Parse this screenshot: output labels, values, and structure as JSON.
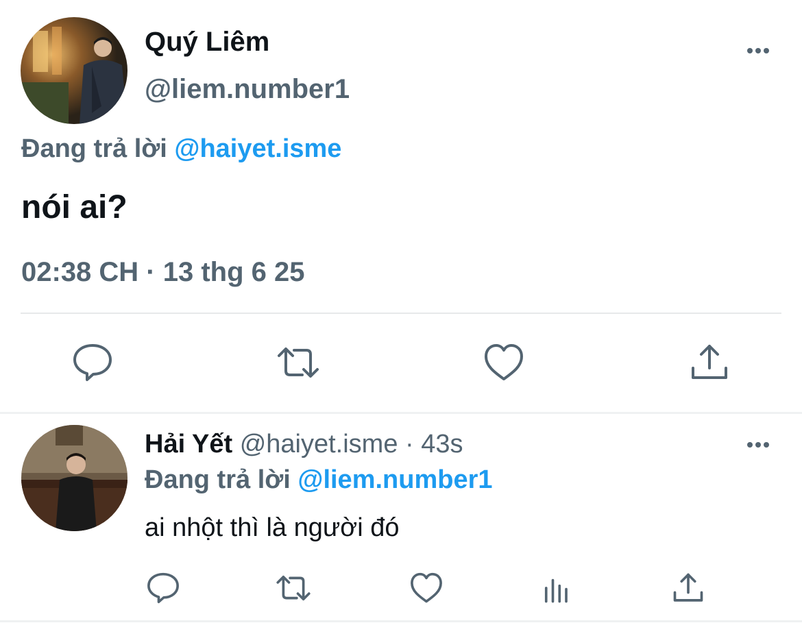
{
  "main_tweet": {
    "display_name": "Quý Liêm",
    "handle": "@liem.number1",
    "replying_prefix": "Đang trả lời ",
    "replying_to": "@haiyet.isme",
    "text": "nói ai?",
    "timestamp": "02:38 CH · 13 thg 6 25",
    "actions": [
      "reply-icon",
      "retweet-icon",
      "like-icon",
      "share-icon"
    ]
  },
  "reply_tweet": {
    "display_name": "Hải Yết",
    "handle": "@haiyet.isme",
    "separator": " · ",
    "age": "43s",
    "replying_prefix": "Đang trả lời ",
    "replying_to": "@liem.number1",
    "text": "ai nhột thì là người đó",
    "actions": [
      "reply-icon",
      "retweet-icon",
      "like-icon",
      "views-icon",
      "share-icon"
    ]
  },
  "colors": {
    "text_primary": "#0f1419",
    "text_secondary": "#536471",
    "accent": "#1d9bf0",
    "divider": "#e7e9ea"
  }
}
